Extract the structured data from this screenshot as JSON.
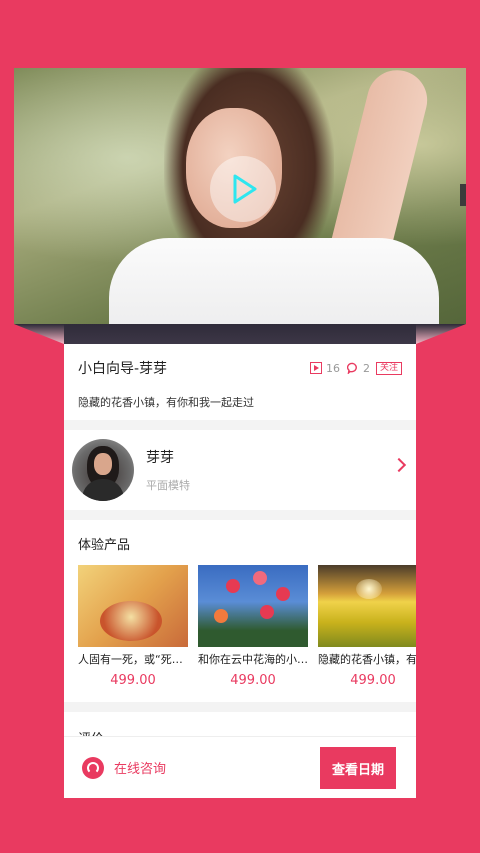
{
  "video": {
    "play_icon": "play-icon"
  },
  "info": {
    "title": "小白向导-芽芽",
    "views": "16",
    "comments": "2",
    "follow_label": "关注",
    "subtitle": "隐藏的花香小镇，有你和我一起走过"
  },
  "profile": {
    "name": "芽芽",
    "role": "平面模特"
  },
  "products": {
    "title": "体验产品",
    "items": [
      {
        "name": "人固有一死，或“死”…",
        "price": "499.00"
      },
      {
        "name": "和你在云中花海的小…",
        "price": "499.00"
      },
      {
        "name": "隐藏的花香小镇，有",
        "price": "499.00"
      }
    ]
  },
  "review": {
    "title": "评价"
  },
  "bottom": {
    "consult_label": "在线咨询",
    "date_button": "查看日期"
  },
  "colors": {
    "accent": "#e93a60"
  }
}
